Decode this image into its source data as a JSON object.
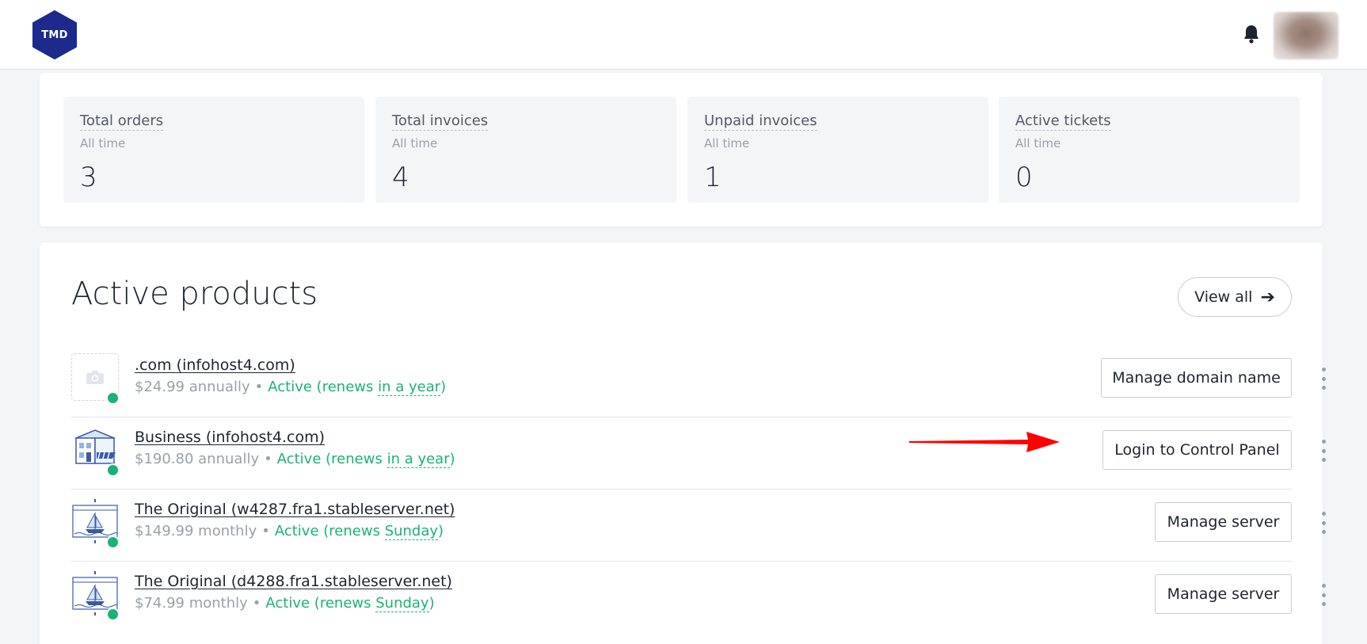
{
  "header": {
    "logo_text": "TMD",
    "logo_color": "#1d2a8c",
    "bell_icon": "bell-icon",
    "avatar_icon": "user-avatar"
  },
  "stats": [
    {
      "title": "Total orders",
      "subtitle": "All time",
      "value": "3"
    },
    {
      "title": "Total invoices",
      "subtitle": "All time",
      "value": "4"
    },
    {
      "title": "Unpaid invoices",
      "subtitle": "All time",
      "value": "1"
    },
    {
      "title": "Active tickets",
      "subtitle": "All time",
      "value": "0"
    }
  ],
  "products": {
    "title": "Active products",
    "view_all": "View all",
    "view_all_icon": "arrow-right-icon",
    "items": [
      {
        "name": ".com (infohost4.com)",
        "price": "$24.99 annually",
        "status": "Active (renews",
        "renew": "in a year",
        "close": ")",
        "action": "Manage domain name",
        "icon": "camera-placeholder-icon"
      },
      {
        "name": "Business (infohost4.com)",
        "price": "$190.80 annually",
        "status": "Active (renews",
        "renew": "in a year",
        "close": ")",
        "action": "Login to Control Panel",
        "icon": "building-icon"
      },
      {
        "name": "The Original (w4287.fra1.stableserver.net)",
        "price": "$149.99 monthly",
        "status": "Active (renews",
        "renew": "Sunday",
        "close": ")",
        "action": "Manage server",
        "icon": "sailboat-icon"
      },
      {
        "name": "The Original (d4288.fra1.stableserver.net)",
        "price": "$74.99 monthly",
        "status": "Active (renews",
        "renew": "Sunday",
        "close": ")",
        "action": "Manage server",
        "icon": "sailboat-icon"
      }
    ]
  },
  "colors": {
    "accent_green": "#1ab277",
    "annotation_red": "#ff0000",
    "brand_navy": "#1d2a8c"
  }
}
